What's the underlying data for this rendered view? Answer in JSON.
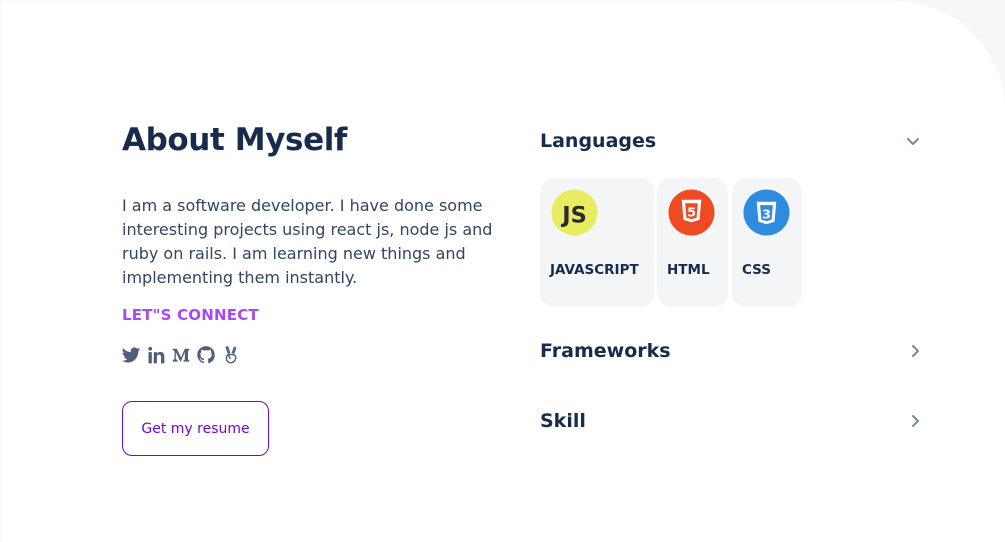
{
  "about": {
    "title": "About Myself",
    "description": "I am a software developer. I have done some interesting projects using react js, node js and ruby on rails. I am learning new things and implementing them instantly.",
    "connect_label": "LET\"S CONNECT",
    "socials": [
      "twitter-icon",
      "linkedin-icon",
      "medium-icon",
      "github-icon",
      "angellist-icon"
    ],
    "resume_button": "Get my resume"
  },
  "skills": {
    "languages": {
      "title": "Languages",
      "expanded": true,
      "items": [
        {
          "name": "JAVASCRIPT",
          "icon": "javascript-icon",
          "badge_text": "JS",
          "color": "#e8ec62"
        },
        {
          "name": "HTML",
          "icon": "html5-icon",
          "badge_text": "5",
          "color": "#ef4a23"
        },
        {
          "name": "CSS",
          "icon": "css3-icon",
          "badge_text": "3",
          "color": "#2f8bde"
        }
      ]
    },
    "frameworks": {
      "title": "Frameworks",
      "expanded": false
    },
    "skill": {
      "title": "Skill",
      "expanded": false
    }
  },
  "colors": {
    "heading": "#172b4d",
    "accent": "#a54af5",
    "button": "#6b0ad9"
  }
}
